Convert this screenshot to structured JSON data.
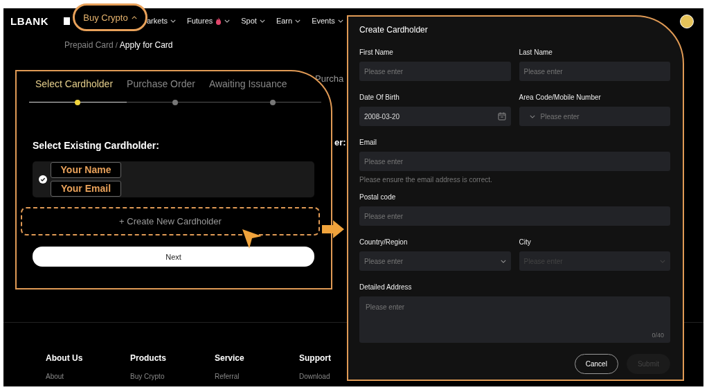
{
  "nav": {
    "logo": "LBANK",
    "items": [
      {
        "label": "arkets",
        "hot": false
      },
      {
        "label": "Futures",
        "hot": true
      },
      {
        "label": "Spot",
        "hot": false
      },
      {
        "label": "Earn",
        "hot": false
      },
      {
        "label": "Events",
        "hot": false
      }
    ]
  },
  "buy_crypto_callout": {
    "label": "Buy Crypto",
    "expanded": true
  },
  "breadcrumb": {
    "separator": "/",
    "items": [
      {
        "label": "Prepaid Card",
        "current": false
      },
      {
        "label": "Apply for Card",
        "current": true
      }
    ]
  },
  "background_peek": {
    "step": "Purcha",
    "heading": "er:"
  },
  "steps_panel": {
    "steps": [
      {
        "label": "Select Cardholder",
        "selected": true
      },
      {
        "label": "Purchase Order",
        "selected": false
      },
      {
        "label": "Awaiting Issuance",
        "selected": false
      }
    ],
    "heading": "Select Existing Cardholder:",
    "cardholders": [
      {
        "name": "Your Name",
        "email": "Your Email",
        "selected": true
      }
    ],
    "create_link": "+ Create New Cardholder",
    "next": "Next"
  },
  "modal": {
    "title": "Create Cardholder",
    "rows": [
      [
        {
          "label": "First Name",
          "kind": "text",
          "placeholder": "Please enter"
        },
        {
          "label": "Last Name",
          "kind": "text",
          "placeholder": "Please enter"
        }
      ],
      [
        {
          "label": "Date Of Birth",
          "kind": "date",
          "value": "2008-03-20"
        },
        {
          "label": "Area Code/Mobile Number",
          "kind": "phone",
          "placeholder": "Please enter"
        }
      ],
      [
        {
          "label": "Email",
          "kind": "text",
          "placeholder": "Please enter",
          "hint": "Please ensure the email address is correct."
        }
      ],
      [
        {
          "label": "Postal code",
          "kind": "text",
          "placeholder": "Please enter"
        }
      ],
      [
        {
          "label": "Country/Region",
          "kind": "select",
          "placeholder": "Please enter",
          "disabled": false
        },
        {
          "label": "City",
          "kind": "select",
          "placeholder": "Please enter",
          "disabled": true
        }
      ],
      [
        {
          "label": "Detailed Address",
          "kind": "textarea",
          "placeholder": "Please enter",
          "counter": "0/40"
        }
      ]
    ],
    "buttons": [
      {
        "label": "Cancel",
        "disabled": false
      },
      {
        "label": "Submit",
        "disabled": true
      }
    ]
  },
  "footer": {
    "columns": [
      {
        "heading": "About Us",
        "links": [
          "About"
        ]
      },
      {
        "heading": "Products",
        "links": [
          "Buy Crypto"
        ]
      },
      {
        "heading": "Service",
        "links": [
          "Referral"
        ]
      },
      {
        "heading": "Support",
        "links": [
          "Download"
        ]
      }
    ]
  }
}
